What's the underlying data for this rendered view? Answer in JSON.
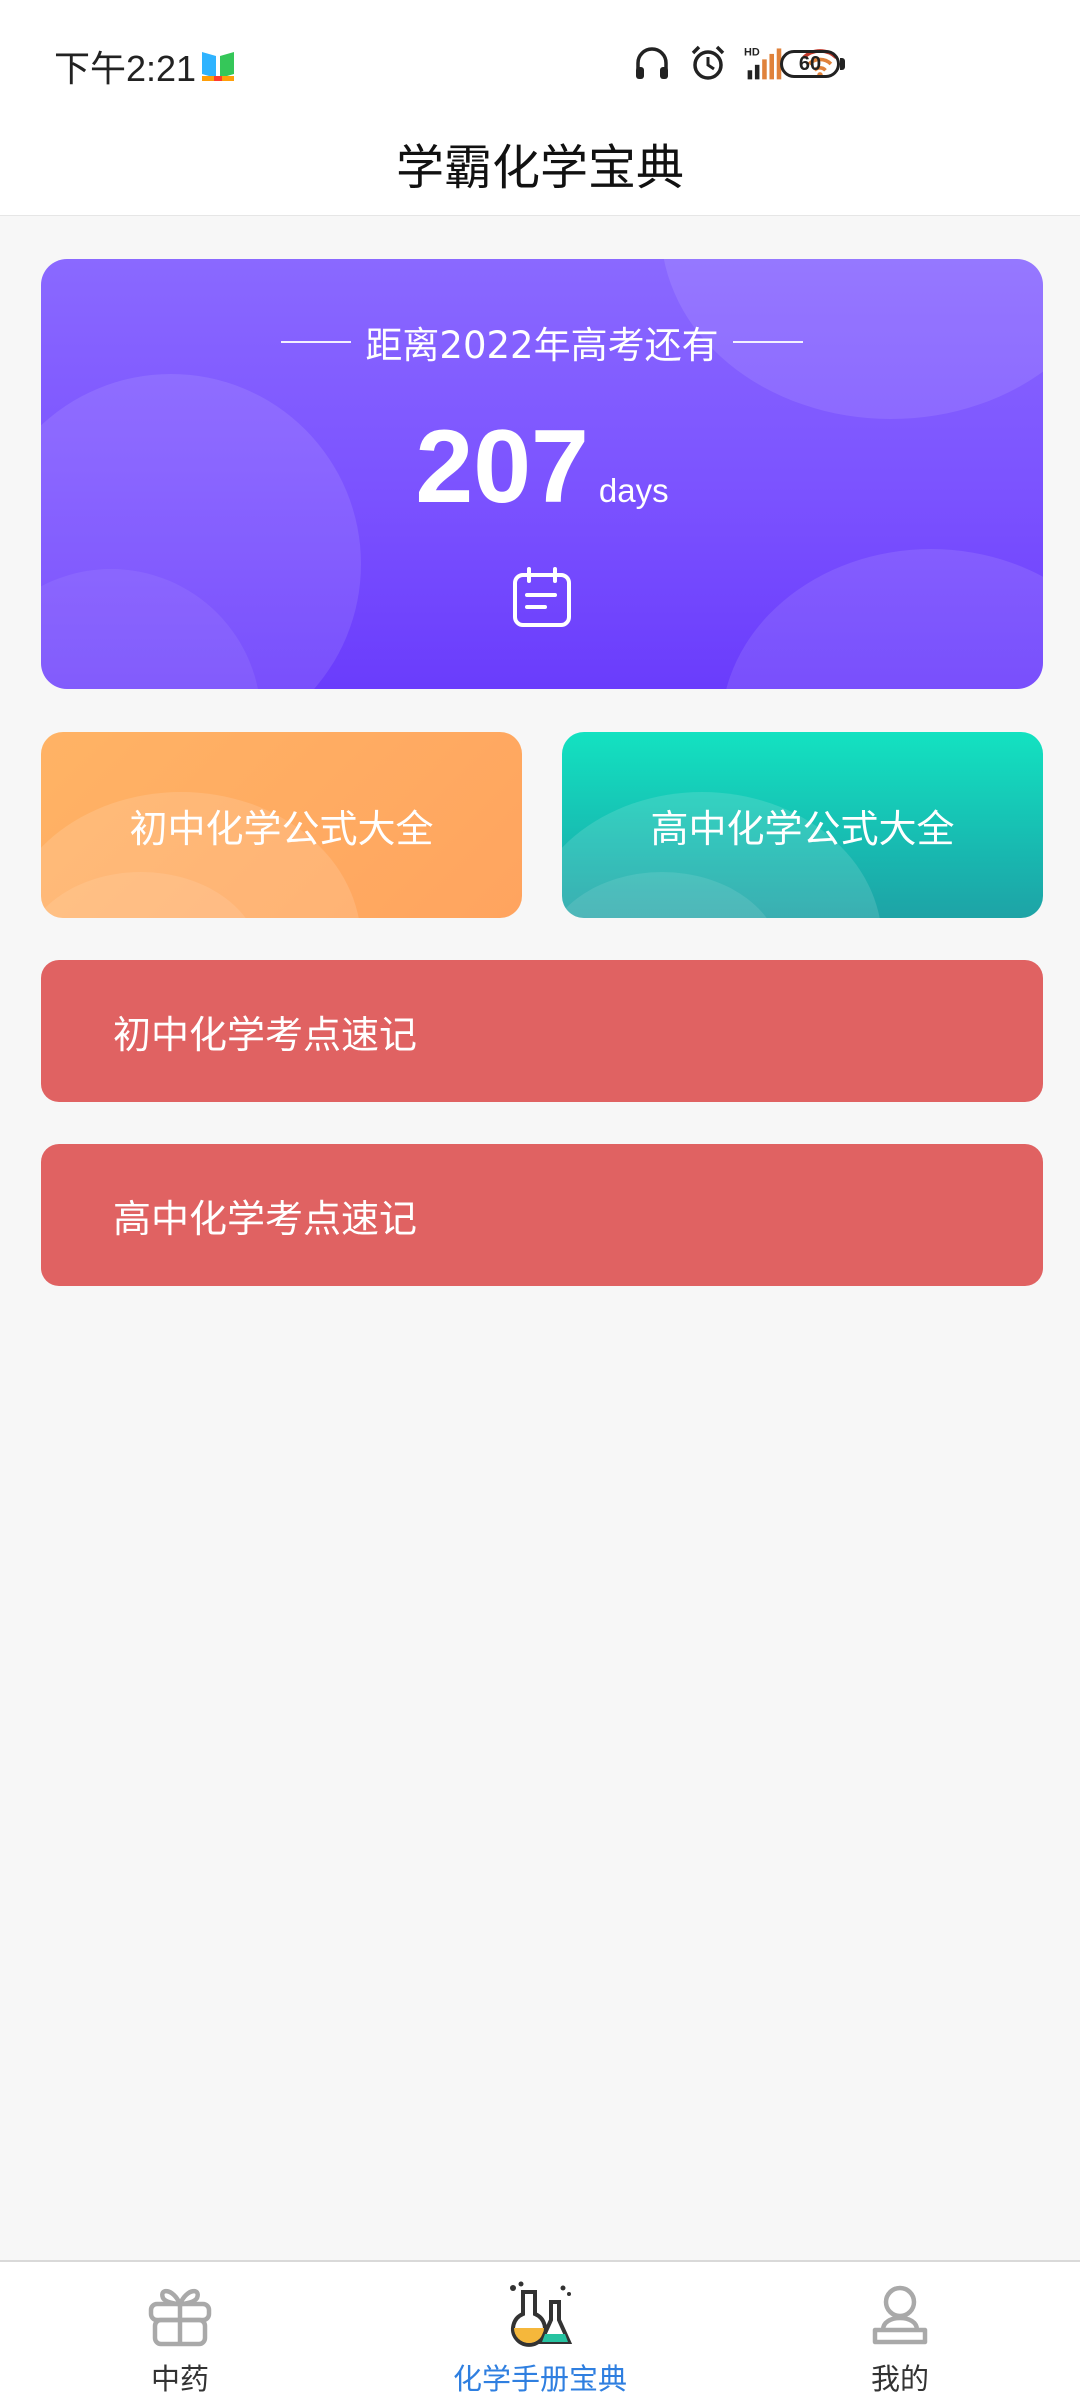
{
  "status_bar": {
    "time": "下午2:21",
    "icons": [
      "headphones-icon",
      "alarm-icon",
      "hd-signal-icon",
      "wifi-icon"
    ],
    "battery": "60"
  },
  "header": {
    "title": "学霸化学宝典"
  },
  "countdown": {
    "label": "距离2022年高考还有",
    "number": "207",
    "unit": "days",
    "icon": "calendar-icon"
  },
  "formula_buttons": [
    {
      "label": "初中化学公式大全",
      "color": "#ffab62"
    },
    {
      "label": "高中化学公式大全",
      "color": "#18c4b6"
    }
  ],
  "kaodian_buttons": [
    {
      "label": "初中化学考点速记",
      "color": "#e06262"
    },
    {
      "label": "高中化学考点速记",
      "color": "#e06262"
    }
  ],
  "bottom_nav": {
    "items": [
      {
        "label": "中药",
        "icon": "gift-icon",
        "active": false
      },
      {
        "label": "化学手册宝典",
        "icon": "flask-icon",
        "active": true
      },
      {
        "label": "我的",
        "icon": "user-icon",
        "active": false
      }
    ],
    "active_color": "#2f7fe0"
  },
  "colors": {
    "countdown_bg": "#7b52ff",
    "page_bg": "#f7f7f7"
  }
}
